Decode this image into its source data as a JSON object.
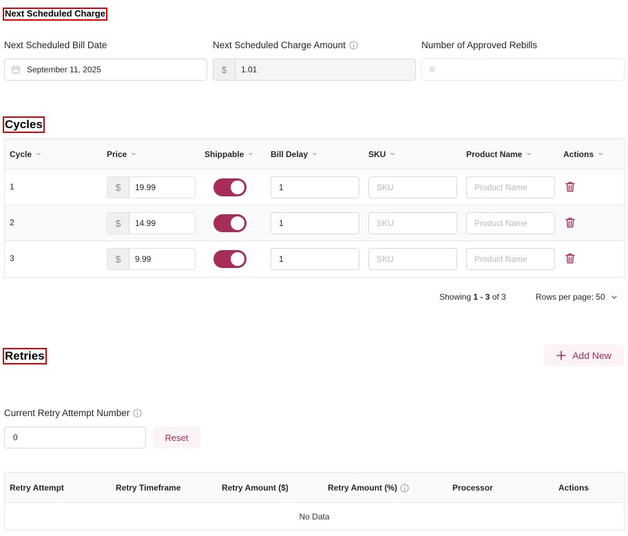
{
  "next_charge": {
    "title": "Next Scheduled Charge",
    "bill_date": {
      "label": "Next Scheduled Bill Date",
      "value": "September 11, 2025"
    },
    "charge_amount": {
      "label": "Next Scheduled Charge Amount",
      "currency_symbol": "$",
      "value": "1.01"
    },
    "approved_rebills": {
      "label": "Number of Approved Rebills",
      "placeholder": "0"
    }
  },
  "cycles": {
    "title": "Cycles",
    "columns": [
      "Cycle",
      "Price",
      "Shippable",
      "Bill Delay",
      "SKU",
      "Product Name",
      "Actions"
    ],
    "rows": [
      {
        "cycle": "1",
        "price": "19.99",
        "shippable": true,
        "bill_delay": "1",
        "sku_placeholder": "SKU",
        "product_placeholder": "Product Name"
      },
      {
        "cycle": "2",
        "price": "14.99",
        "shippable": true,
        "bill_delay": "1",
        "sku_placeholder": "SKU",
        "product_placeholder": "Product Name"
      },
      {
        "cycle": "3",
        "price": "9.99",
        "shippable": true,
        "bill_delay": "1",
        "sku_placeholder": "SKU",
        "product_placeholder": "Product Name"
      }
    ],
    "currency_symbol": "$",
    "pagination": {
      "showing_prefix": "Showing",
      "range": "1 - 3",
      "of_text": "of 3",
      "rows_per_page": "Rows per page: 50"
    }
  },
  "retries": {
    "title": "Retries",
    "add_new_label": "Add New",
    "current_attempt": {
      "label": "Current Retry Attempt Number",
      "value": "0"
    },
    "reset_label": "Reset",
    "columns": [
      "Retry Attempt",
      "Retry Timeframe",
      "Retry Amount ($)",
      "Retry Amount (%)",
      "Processor",
      "Actions"
    ],
    "empty_text": "No Data"
  },
  "colors": {
    "accent": "#a82c58",
    "accent_light": "#fbf3f5",
    "border": "#d9d9d9"
  },
  "icons": [
    "calendar-icon",
    "info-icon",
    "trash-icon",
    "plus-icon",
    "chevron-down-icon"
  ]
}
